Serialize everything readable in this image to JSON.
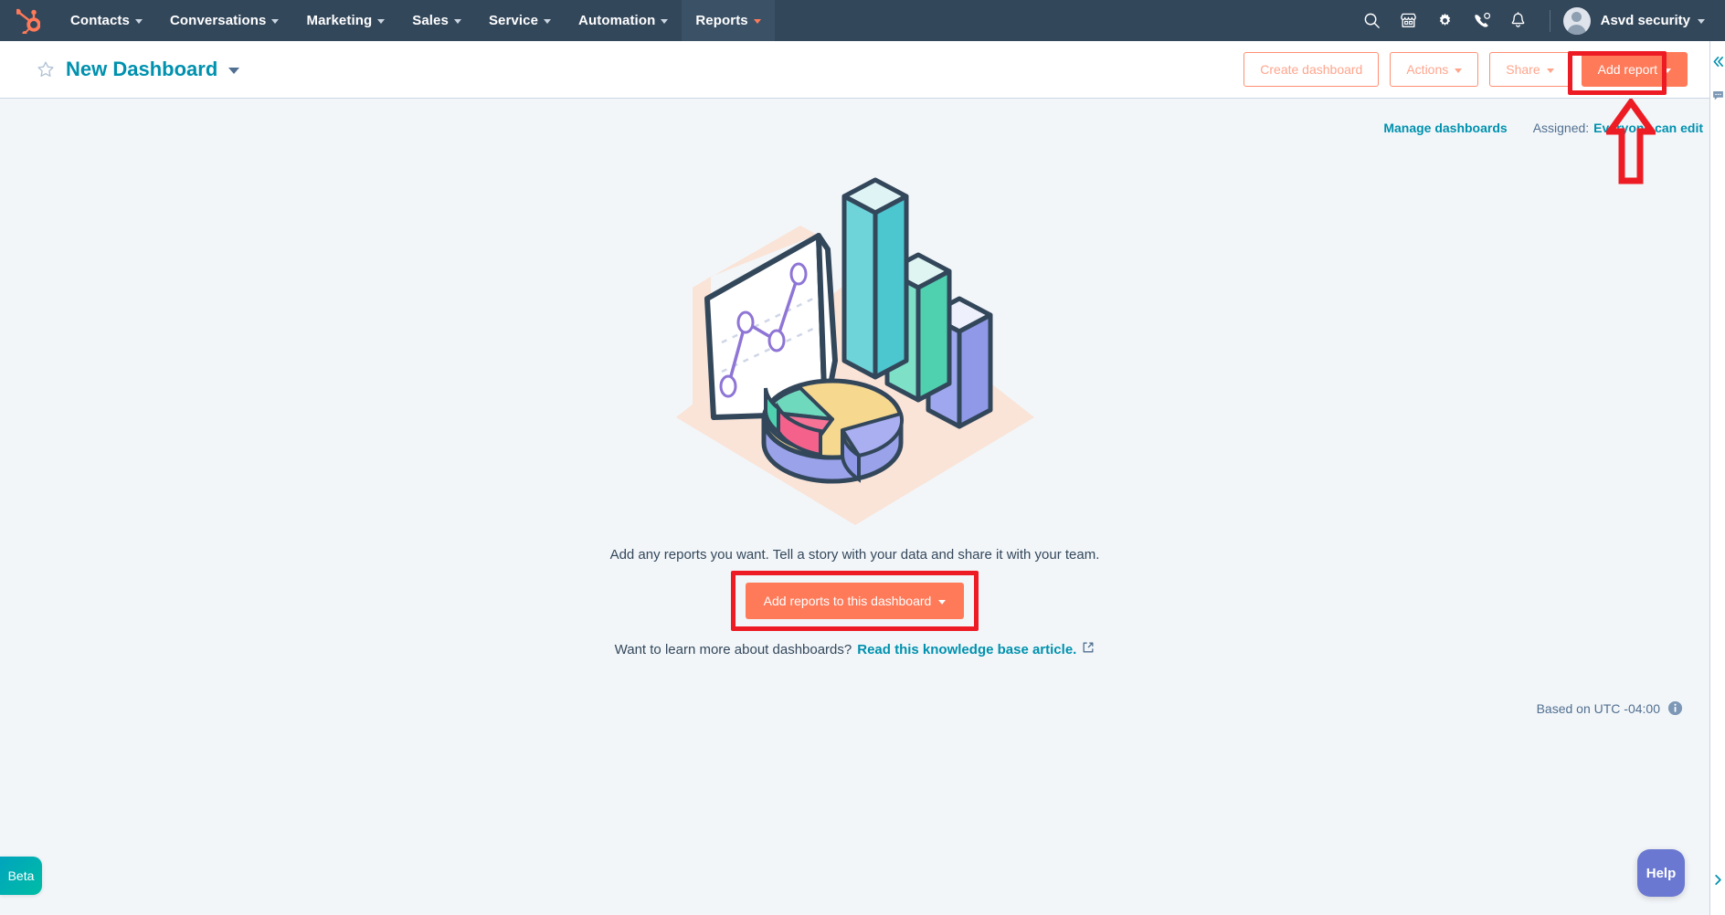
{
  "nav": {
    "logo_name": "hubspot-logo",
    "items": [
      {
        "label": "Contacts",
        "icon": "chevron-down-icon",
        "active": false
      },
      {
        "label": "Conversations",
        "icon": "chevron-down-icon",
        "active": false
      },
      {
        "label": "Marketing",
        "icon": "chevron-down-icon",
        "active": false
      },
      {
        "label": "Sales",
        "icon": "chevron-down-icon",
        "active": false
      },
      {
        "label": "Service",
        "icon": "chevron-down-icon",
        "active": false
      },
      {
        "label": "Automation",
        "icon": "chevron-down-icon",
        "active": false
      },
      {
        "label": "Reports",
        "icon": "chevron-down-icon",
        "active": true
      }
    ],
    "right_icons": [
      "search-icon",
      "marketplace-icon",
      "gear-icon",
      "calling-icon",
      "notifications-bell-icon"
    ],
    "user": {
      "name": "Asvd security",
      "avatar": "user-avatar",
      "caret": "chevron-down-icon"
    }
  },
  "header": {
    "favorite_icon": "star-outline-icon",
    "title": "New Dashboard",
    "title_caret": "chevron-down-icon",
    "buttons": [
      {
        "label": "Create dashboard",
        "style": "outline",
        "caret": false
      },
      {
        "label": "Actions",
        "style": "outline",
        "caret": true
      },
      {
        "label": "Share",
        "style": "outline",
        "caret": true
      },
      {
        "label": "Add report",
        "style": "primary",
        "caret": true
      }
    ]
  },
  "subheader": {
    "manage_dashboards": "Manage dashboards",
    "assigned_label": "Assigned:",
    "assigned_value": "Everyone can edit"
  },
  "annotations": {
    "box_color": "#ed1c24",
    "arrow_color": "#ed1c24",
    "arrow_name": "red-up-arrow-annotation",
    "targets": [
      "Add report",
      "Add reports to this dashboard"
    ]
  },
  "empty_state": {
    "illustration": "dashboard-charts-illustration",
    "description": "Add any reports you want. Tell a story with your data and share it with your team.",
    "cta_label": "Add reports to this dashboard",
    "cta_caret": "chevron-down-icon",
    "learn_prefix": "Want to learn more about dashboards?",
    "learn_link": "Read this knowledge base article.",
    "learn_link_icon": "external-link-icon"
  },
  "footer": {
    "utc_text": "Based on UTC -04:00",
    "info_icon": "info-circle-icon"
  },
  "widgets": {
    "beta_label": "Beta",
    "help_label": "Help"
  },
  "right_rail": {
    "collapse_icon": "double-chevron-left-icon",
    "chat_icon": "chat-bubble-icon",
    "expand_icon": "chevron-right-icon"
  },
  "colors": {
    "nav_bg": "#33475b",
    "page_bg": "#f2f6f9",
    "brand_orange": "#ff7a59",
    "link_teal": "#0091ae",
    "annotation_red": "#ed1c24",
    "beta_teal": "#00bda5",
    "help_purple": "#6a78d1"
  }
}
